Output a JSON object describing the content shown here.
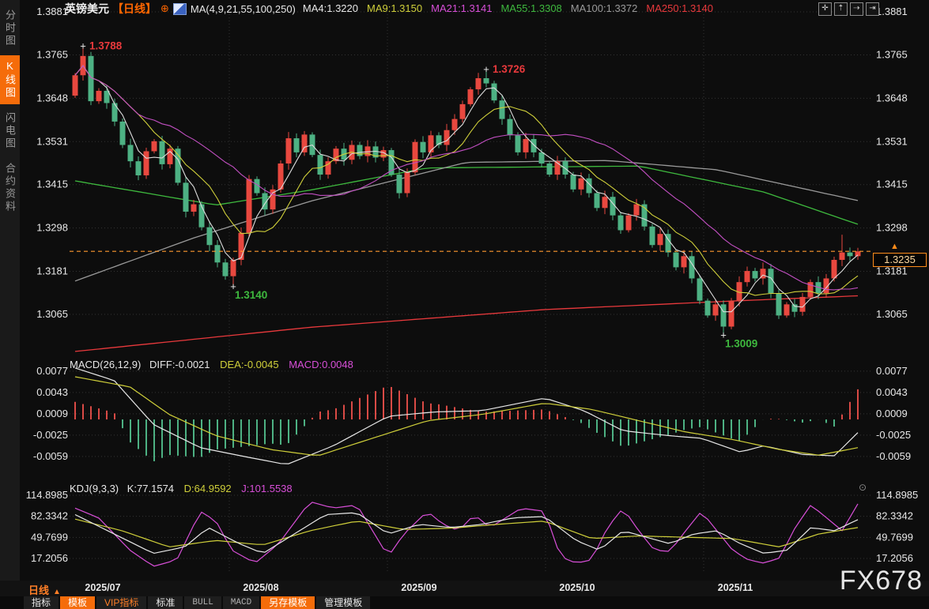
{
  "colors": {
    "background": "#0d0d0d",
    "up_red": "#e8483f",
    "down_green": "#4db183",
    "accent_orange": "#ff6600",
    "last_price_orange": "#ff9a2e",
    "grid": "#343434",
    "annotation_red": "#e8393c",
    "annotation_green": "#3eb93e"
  },
  "sidebar": {
    "tabs": [
      {
        "label": "分时图",
        "active": false
      },
      {
        "label": "K线图",
        "active": true
      },
      {
        "label": "闪电图",
        "active": false
      },
      {
        "label": "合约资料",
        "active": false
      }
    ]
  },
  "header": {
    "symbol": "英镑美元",
    "period_tag": "【日线】",
    "plus_icon": "⊕",
    "ma_group": "MA(4,9,21,55,100,250)",
    "ma_items": [
      {
        "text": "MA4:1.3220",
        "color": "#e8e8e8"
      },
      {
        "text": "MA9:1.3150",
        "color": "#cfcf3a"
      },
      {
        "text": "MA21:1.3141",
        "color": "#d84fd8"
      },
      {
        "text": "MA55:1.3308",
        "color": "#3eb93e"
      },
      {
        "text": "MA100:1.3372",
        "color": "#9a9a9a"
      },
      {
        "text": "MA250:1.3140",
        "color": "#e8393c"
      }
    ],
    "toolbar_icons": [
      {
        "name": "pan-icon",
        "glyph": "✛"
      },
      {
        "name": "axis-scale-y-icon",
        "glyph": "⇡"
      },
      {
        "name": "axis-scale-x-icon",
        "glyph": "⇢"
      },
      {
        "name": "shift-right-icon",
        "glyph": "⇥"
      }
    ]
  },
  "macd_pane": {
    "title": "MACD(26,12,9)",
    "diff_label": "DIFF:-0.0021",
    "dea_label": "DEA:-0.0045",
    "macd_label": "MACD:0.0048",
    "axis_labels": [
      "0.0077",
      "0.0043",
      "0.0009",
      "-0.0025",
      "-0.0059"
    ]
  },
  "kdj_pane": {
    "title": "KDJ(9,3,3)",
    "k_label": "K:77.1574",
    "d_label": "D:64.9592",
    "j_label": "J:101.5538",
    "axis_labels": [
      "114.8985",
      "82.3342",
      "49.7699",
      "17.2056"
    ],
    "settings_icon": "⊙"
  },
  "xaxis": {
    "period_label": "日线",
    "period_arrow": "▲"
  },
  "price_marker": {
    "last_price_label": "1.3235",
    "arrow": "▲"
  },
  "footer": {
    "tabs": [
      {
        "label": "指标",
        "style": "plain"
      },
      {
        "label": "模板",
        "style": "orange-bg"
      },
      {
        "label": "VIP指标",
        "style": "orange-text"
      },
      {
        "label": "标准",
        "style": "plain"
      },
      {
        "label": "BULL",
        "style": "dim"
      },
      {
        "label": "MACD",
        "style": "dim"
      },
      {
        "label": "另存模板",
        "style": "orange-bg"
      },
      {
        "label": "管理模板",
        "style": "plain"
      }
    ]
  },
  "watermark": "FX678",
  "chart_data": {
    "type": "candlestick",
    "symbol": "英镑美元 GBP/USD",
    "interval": "日线 (daily)",
    "price_axis_labels": [
      "1.3881",
      "1.3765",
      "1.3648",
      "1.3531",
      "1.3415",
      "1.3298",
      "1.3181",
      "1.3065"
    ],
    "price_axis_values": [
      1.3881,
      1.3765,
      1.3648,
      1.3531,
      1.3415,
      1.3298,
      1.3181,
      1.3065
    ],
    "last_price": 1.3235,
    "x_months": [
      {
        "label": "2025/07",
        "start_index": 0
      },
      {
        "label": "2025/08",
        "start_index": 20
      },
      {
        "label": "2025/09",
        "start_index": 40
      },
      {
        "label": "2025/10",
        "start_index": 60
      },
      {
        "label": "2025/11",
        "start_index": 80
      }
    ],
    "candles": {
      "first_open": 1.3655,
      "closes": [
        1.371,
        1.3762,
        1.364,
        1.3668,
        1.3635,
        1.3585,
        1.3522,
        1.3478,
        1.344,
        1.3505,
        1.3532,
        1.347,
        1.3512,
        1.342,
        1.3342,
        1.3362,
        1.33,
        1.3252,
        1.3205,
        1.3168,
        1.3212,
        1.3285,
        1.343,
        1.3392,
        1.3348,
        1.3402,
        1.3472,
        1.354,
        1.3502,
        1.355,
        1.3495,
        1.3442,
        1.3478,
        1.3512,
        1.3482,
        1.3522,
        1.3492,
        1.3518,
        1.3488,
        1.3508,
        1.3442,
        1.3392,
        1.3448,
        1.353,
        1.3502,
        1.3548,
        1.3522,
        1.3562,
        1.3592,
        1.3632,
        1.3672,
        1.3702,
        1.3688,
        1.3642,
        1.3592,
        1.3548,
        1.3502,
        1.3538,
        1.3502,
        1.3472,
        1.3442,
        1.3478,
        1.3442,
        1.3402,
        1.3432,
        1.3392,
        1.3352,
        1.3382,
        1.3332,
        1.3292,
        1.3332,
        1.3362,
        1.3302,
        1.3252,
        1.3282,
        1.3232,
        1.3192,
        1.3222,
        1.3162,
        1.3102,
        1.3062,
        1.3092,
        1.3032,
        1.3102,
        1.3152,
        1.3182,
        1.3162,
        1.3188,
        1.3122,
        1.3062,
        1.3092,
        1.3072,
        1.3112,
        1.3152,
        1.3122,
        1.3162,
        1.3212,
        1.3232,
        1.3222,
        1.3235
      ],
      "wick_overrides": {
        "1": {
          "h": 1.3788
        },
        "20": {
          "l": 1.314
        },
        "52": {
          "h": 1.3726
        },
        "82": {
          "l": 1.3009
        },
        "97": {
          "h": 1.328
        }
      }
    },
    "annotations": [
      {
        "text": "1.3788",
        "index": 1,
        "price": 1.3788,
        "side": "above",
        "color": "#e8393c"
      },
      {
        "text": "1.3726",
        "index": 52,
        "price": 1.3726,
        "side": "above",
        "color": "#e8393c"
      },
      {
        "text": "1.3140",
        "index": 20,
        "price": 1.314,
        "side": "below",
        "color": "#3eb93e"
      },
      {
        "text": "1.3009",
        "index": 82,
        "price": 1.3009,
        "side": "below",
        "color": "#3eb93e"
      }
    ],
    "ma_computed": [
      {
        "name": "MA4",
        "window": 4,
        "color": "#dcdcdc"
      },
      {
        "name": "MA9",
        "window": 9,
        "color": "#cfcf3a"
      },
      {
        "name": "MA21",
        "window": 21,
        "color": "#c24fc2"
      }
    ],
    "ma_anchored": [
      {
        "name": "MA55",
        "color": "#3eb93e",
        "points": [
          [
            0,
            1.3425
          ],
          [
            0.18,
            1.336
          ],
          [
            0.3,
            1.34
          ],
          [
            0.45,
            1.346
          ],
          [
            0.72,
            1.3465
          ],
          [
            0.88,
            1.3395
          ],
          [
            1,
            1.3308
          ]
        ]
      },
      {
        "name": "MA100",
        "color": "#9a9a9a",
        "points": [
          [
            0,
            1.3155
          ],
          [
            0.15,
            1.327
          ],
          [
            0.3,
            1.337
          ],
          [
            0.5,
            1.3475
          ],
          [
            0.68,
            1.348
          ],
          [
            0.82,
            1.3455
          ],
          [
            1,
            1.3372
          ]
        ]
      },
      {
        "name": "MA250",
        "color": "#e8393c",
        "points": [
          [
            0,
            1.2965
          ],
          [
            0.3,
            1.303
          ],
          [
            0.6,
            1.3078
          ],
          [
            0.85,
            1.3102
          ],
          [
            1,
            1.3115
          ]
        ]
      }
    ],
    "macd": {
      "params": "26,12,9",
      "diff": -0.0021,
      "dea": -0.0045,
      "macd": 0.0048,
      "axis_values": [
        0.0077,
        0.0043,
        0.0009,
        -0.0025,
        -0.0059
      ],
      "diff_line": [
        [
          0,
          0.0082
        ],
        [
          0.05,
          0.0062
        ],
        [
          0.1,
          -0.0008
        ],
        [
          0.16,
          -0.0045
        ],
        [
          0.22,
          -0.006
        ],
        [
          0.27,
          -0.0072
        ],
        [
          0.33,
          -0.0042
        ],
        [
          0.4,
          0.0005
        ],
        [
          0.46,
          0.0012
        ],
        [
          0.52,
          0.0014
        ],
        [
          0.6,
          0.0034
        ],
        [
          0.65,
          0.0014
        ],
        [
          0.7,
          -0.0018
        ],
        [
          0.76,
          -0.0026
        ],
        [
          0.8,
          -0.003
        ],
        [
          0.85,
          -0.0052
        ],
        [
          0.88,
          -0.0042
        ],
        [
          0.93,
          -0.0056
        ],
        [
          0.97,
          -0.0058
        ],
        [
          1,
          -0.0021
        ]
      ],
      "dea_line": [
        [
          0,
          0.0068
        ],
        [
          0.07,
          0.0052
        ],
        [
          0.12,
          0.0008
        ],
        [
          0.18,
          -0.0026
        ],
        [
          0.25,
          -0.0048
        ],
        [
          0.31,
          -0.0058
        ],
        [
          0.38,
          -0.003
        ],
        [
          0.45,
          -0.0002
        ],
        [
          0.52,
          0.0008
        ],
        [
          0.6,
          0.0026
        ],
        [
          0.66,
          0.0016
        ],
        [
          0.72,
          -0.0002
        ],
        [
          0.78,
          -0.002
        ],
        [
          0.84,
          -0.0032
        ],
        [
          0.9,
          -0.0048
        ],
        [
          0.95,
          -0.0057
        ],
        [
          1,
          -0.0045
        ]
      ]
    },
    "kdj": {
      "params": "9,3,3",
      "k": 77.1574,
      "d": 64.9592,
      "j": 101.5538,
      "axis_values": [
        114.8985,
        82.3342,
        49.7699,
        17.2056
      ],
      "j_line": [
        [
          0,
          95
        ],
        [
          0.03,
          80
        ],
        [
          0.07,
          30
        ],
        [
          0.1,
          5
        ],
        [
          0.13,
          15
        ],
        [
          0.16,
          90
        ],
        [
          0.18,
          75
        ],
        [
          0.2,
          30
        ],
        [
          0.23,
          10
        ],
        [
          0.26,
          40
        ],
        [
          0.3,
          105
        ],
        [
          0.33,
          95
        ],
        [
          0.36,
          100
        ],
        [
          0.38,
          60
        ],
        [
          0.4,
          20
        ],
        [
          0.42,
          55
        ],
        [
          0.45,
          90
        ],
        [
          0.47,
          70
        ],
        [
          0.49,
          60
        ],
        [
          0.51,
          85
        ],
        [
          0.53,
          65
        ],
        [
          0.55,
          80
        ],
        [
          0.57,
          95
        ],
        [
          0.6,
          90
        ],
        [
          0.62,
          20
        ],
        [
          0.64,
          10
        ],
        [
          0.66,
          15
        ],
        [
          0.68,
          65
        ],
        [
          0.7,
          95
        ],
        [
          0.72,
          60
        ],
        [
          0.74,
          30
        ],
        [
          0.76,
          28
        ],
        [
          0.78,
          60
        ],
        [
          0.8,
          90
        ],
        [
          0.82,
          60
        ],
        [
          0.84,
          30
        ],
        [
          0.86,
          15
        ],
        [
          0.88,
          10
        ],
        [
          0.9,
          18
        ],
        [
          0.92,
          65
        ],
        [
          0.94,
          100
        ],
        [
          0.96,
          80
        ],
        [
          0.98,
          60
        ],
        [
          1,
          101.5538
        ]
      ],
      "k_line": [
        [
          0,
          85
        ],
        [
          0.05,
          55
        ],
        [
          0.1,
          25
        ],
        [
          0.14,
          35
        ],
        [
          0.17,
          65
        ],
        [
          0.21,
          40
        ],
        [
          0.24,
          25
        ],
        [
          0.28,
          55
        ],
        [
          0.32,
          85
        ],
        [
          0.36,
          88
        ],
        [
          0.4,
          55
        ],
        [
          0.44,
          70
        ],
        [
          0.48,
          65
        ],
        [
          0.52,
          70
        ],
        [
          0.56,
          80
        ],
        [
          0.6,
          82
        ],
        [
          0.64,
          45
        ],
        [
          0.67,
          30
        ],
        [
          0.7,
          60
        ],
        [
          0.73,
          50
        ],
        [
          0.76,
          40
        ],
        [
          0.79,
          55
        ],
        [
          0.82,
          60
        ],
        [
          0.85,
          40
        ],
        [
          0.88,
          25
        ],
        [
          0.91,
          30
        ],
        [
          0.94,
          65
        ],
        [
          0.97,
          60
        ],
        [
          1,
          77.1574
        ]
      ],
      "d_line": [
        [
          0,
          78
        ],
        [
          0.06,
          60
        ],
        [
          0.12,
          35
        ],
        [
          0.18,
          45
        ],
        [
          0.24,
          38
        ],
        [
          0.3,
          60
        ],
        [
          0.36,
          75
        ],
        [
          0.42,
          62
        ],
        [
          0.48,
          64
        ],
        [
          0.54,
          70
        ],
        [
          0.6,
          75
        ],
        [
          0.66,
          48
        ],
        [
          0.72,
          52
        ],
        [
          0.78,
          50
        ],
        [
          0.84,
          48
        ],
        [
          0.9,
          35
        ],
        [
          0.95,
          55
        ],
        [
          1,
          64.9592
        ]
      ]
    }
  }
}
